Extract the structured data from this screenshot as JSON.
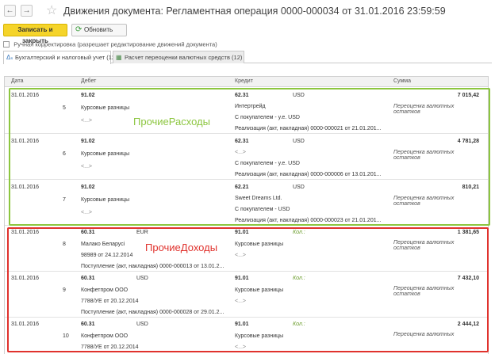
{
  "window": {
    "title": "Движения документа: Регламентная операция 0000-000034 от 31.01.2016 23:59:59"
  },
  "toolbar": {
    "save_close": "Записать и закрыть",
    "refresh": "Обновить"
  },
  "manual_adjust": "Ручная корректировка (разрешает редактирование движений документа)",
  "tabs": [
    {
      "label": "Бухгалтерский и налоговый учет (12)"
    },
    {
      "label": "Расчет переоценки валютных средств (12)"
    }
  ],
  "columns": {
    "date": "Дата",
    "debit": "Дебет",
    "credit": "Кредит",
    "amount": "Сумма"
  },
  "rows": [
    {
      "date": "31.01.2016",
      "num": "5",
      "debit_acc": "91.02",
      "debit_sub1": "Курсовые разницы",
      "debit_sub2": "<...>",
      "debit_cur": "",
      "credit_acc": "62.31",
      "credit_cur": "USD",
      "credit_kol": "",
      "credit_sub1": "Интертрейд",
      "credit_sub2": "С покупателем - у.е. USD",
      "credit_sub3": "Реализация (акт, накладная) 0000-000021 от 21.01.201...",
      "amount": "7 015,42",
      "note": "Переоценка валютных остатков"
    },
    {
      "date": "31.01.2016",
      "num": "6",
      "debit_acc": "91.02",
      "debit_sub1": "Курсовые разницы",
      "debit_sub2": "<...>",
      "debit_cur": "",
      "credit_acc": "62.31",
      "credit_cur": "USD",
      "credit_kol": "",
      "credit_sub1": "<...>",
      "credit_sub2": "С покупателем - у.е. USD",
      "credit_sub3": "Реализация (акт, накладная) 0000-000006 от 13.01.201...",
      "amount": "4 781,28",
      "note": "Переоценка валютных остатков"
    },
    {
      "date": "31.01.2016",
      "num": "7",
      "debit_acc": "91.02",
      "debit_sub1": "Курсовые разницы",
      "debit_sub2": "<...>",
      "debit_cur": "",
      "credit_acc": "62.21",
      "credit_cur": "USD",
      "credit_kol": "",
      "credit_sub1": "Sweet Dreams Ltd.",
      "credit_sub2": "С покупателем - USD",
      "credit_sub3": "Реализация (акт, накладная) 0000-000023 от 21.01.201...",
      "amount": "810,21",
      "note": "Переоценка валютных остатков"
    },
    {
      "date": "31.01.2016",
      "num": "8",
      "debit_acc": "60.31",
      "debit_sub1": "Малако Беларусі",
      "debit_sub2": "98989 от 24.12.2014",
      "debit_cur": "EUR",
      "debit_sub3": "Поступление (акт, накладная) 0000-000013 от 13.01.2...",
      "credit_acc": "91.01",
      "credit_cur": "",
      "credit_kol": "Кол.:",
      "credit_sub1": "Курсовые разницы",
      "credit_sub2": "<...>",
      "credit_sub3": "",
      "amount": "1 381,65",
      "note": "Переоценка валютных остатков"
    },
    {
      "date": "31.01.2016",
      "num": "9",
      "debit_acc": "60.31",
      "debit_sub1": "Конфетпром ООО",
      "debit_sub2": "7788/УЕ от 20.12.2014",
      "debit_cur": "USD",
      "debit_sub3": "Поступление (акт, накладная) 0000-000028 от 29.01.2...",
      "credit_acc": "91.01",
      "credit_cur": "",
      "credit_kol": "Кол.:",
      "credit_sub1": "Курсовые разницы",
      "credit_sub2": "<...>",
      "credit_sub3": "",
      "amount": "7 432,10",
      "note": "Переоценка валютных остатков"
    },
    {
      "date": "31.01.2016",
      "num": "10",
      "debit_acc": "60.31",
      "debit_sub1": "Конфетпром ООО",
      "debit_sub2": "7788/УЕ от 20.12.2014",
      "debit_cur": "USD",
      "debit_sub3": "",
      "credit_acc": "91.01",
      "credit_cur": "",
      "credit_kol": "Кол.:",
      "credit_sub1": "Курсовые разницы",
      "credit_sub2": "<...>",
      "credit_sub3": "",
      "amount": "2 444,12",
      "note": "Переоценка валютных"
    }
  ],
  "annotations": {
    "expenses": "ПрочиеРасходы",
    "income": "ПрочиеДоходы"
  },
  "colors": {
    "primary_button": "#f5d42a",
    "expenses_frame": "#8cc63f",
    "income_frame": "#e0322d"
  }
}
